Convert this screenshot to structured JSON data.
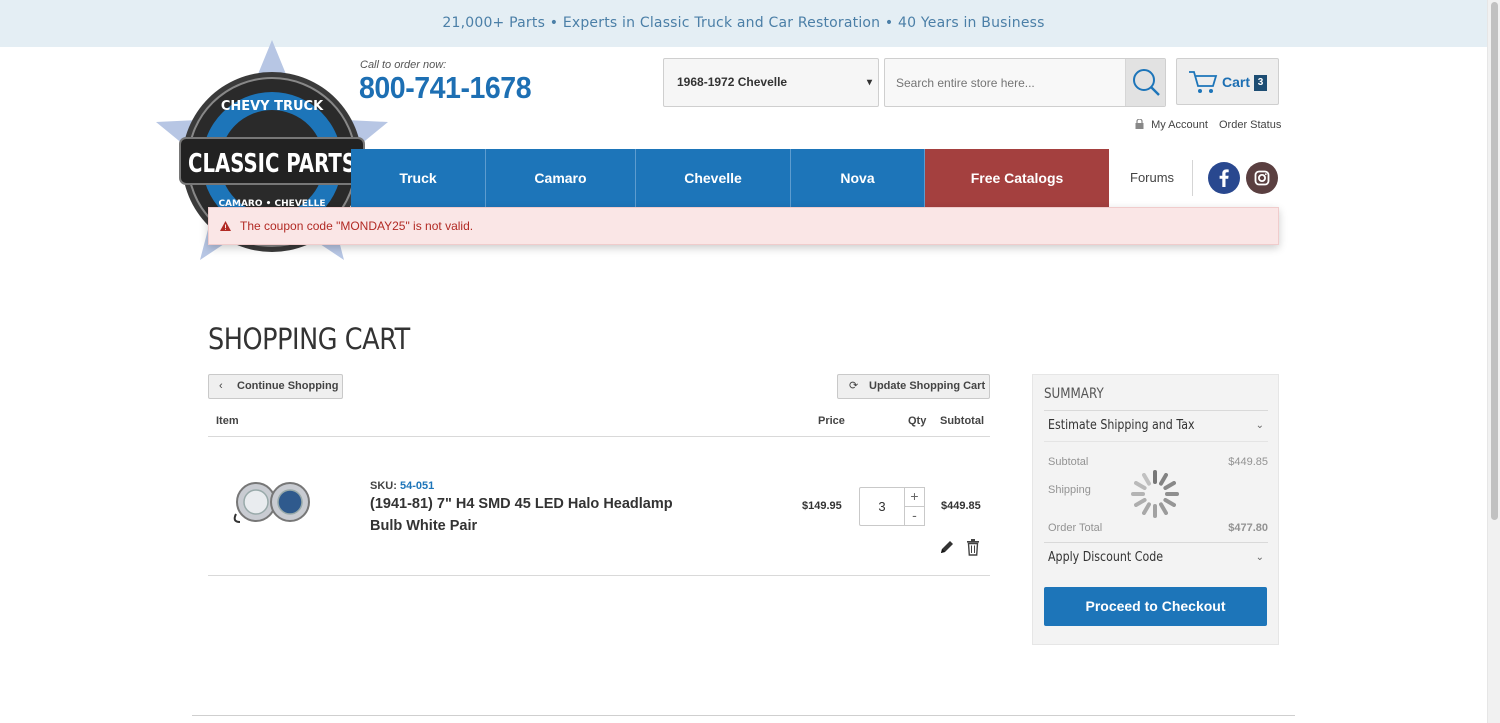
{
  "topbar": {
    "text": "21,000+ Parts • Experts in Classic Truck and Car Restoration • 40 Years in Business"
  },
  "header": {
    "call_label": "Call to order now:",
    "phone": "800-741-1678",
    "vehicle_selected": "1968-1972 Chevelle",
    "search_placeholder": "Search entire store here...",
    "cart_label": "Cart",
    "cart_count": "3",
    "my_account": "My Account",
    "order_status": "Order Status"
  },
  "logo": {
    "ring_top": "CHEVY TRUCK",
    "main": "CLASSIC PARTS",
    "ring_bottom": "CAMARO • CHEVELLE"
  },
  "nav": {
    "items": [
      {
        "label": "Truck"
      },
      {
        "label": "Camaro"
      },
      {
        "label": "Chevelle"
      },
      {
        "label": "Nova"
      },
      {
        "label": "Free Catalogs"
      }
    ],
    "forums": "Forums"
  },
  "alert": {
    "message": "The coupon code \"MONDAY25\" is not valid."
  },
  "page": {
    "title": "SHOPPING CART",
    "continue_label": "Continue Shopping",
    "update_label": "Update Shopping Cart"
  },
  "table": {
    "headers": {
      "item": "Item",
      "price": "Price",
      "qty": "Qty",
      "subtotal": "Subtotal"
    },
    "rows": [
      {
        "sku_label": "SKU:",
        "sku": "54-051",
        "name": "(1941-81) 7\" H4 SMD 45 LED Halo Headlamp Bulb White Pair",
        "price": "$149.95",
        "qty": "3",
        "subtotal": "$449.85"
      }
    ]
  },
  "summary": {
    "title": "SUMMARY",
    "estimate_label": "Estimate Shipping and Tax",
    "subtotal_label": "Subtotal",
    "subtotal_value": "$449.85",
    "shipping_label": "Shipping",
    "order_total_label": "Order Total",
    "order_total_value": "$477.80",
    "discount_label": "Apply Discount Code",
    "checkout_label": "Proceed to Checkout"
  },
  "colors": {
    "primary_blue": "#1d75b9",
    "catalog_red": "#a4403f",
    "alert_bg": "#fae6e6",
    "alert_text": "#b22a24"
  }
}
